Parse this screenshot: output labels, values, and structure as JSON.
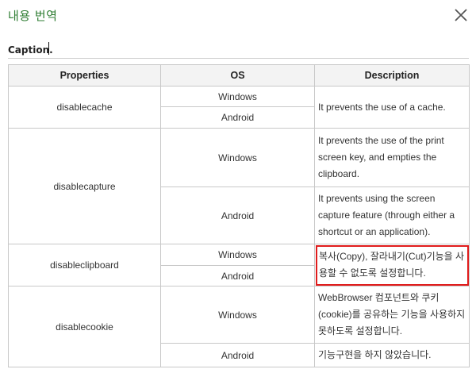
{
  "dialog": {
    "title": "내용 번역",
    "caption": "Caption."
  },
  "table": {
    "headers": [
      "Properties",
      "OS",
      "Description"
    ],
    "rows": [
      {
        "property": "disablecache",
        "windows_os": "Windows",
        "android_os": "Android",
        "description": "It prevents the use of a cache."
      },
      {
        "property": "disablecapture",
        "windows_os": "Windows",
        "android_os": "Android",
        "windows_desc": "It prevents the use of the print screen key, and empties the clipboard.",
        "android_desc": "It prevents using the screen capture feature (through either a shortcut or an application)."
      },
      {
        "property": "disableclipboard",
        "windows_os": "Windows",
        "android_os": "Android",
        "description": "복사(Copy), 잘라내기(Cut)기능을 사용할 수 없도록 설정합니다."
      },
      {
        "property": "disablecookie",
        "windows_os": "Windows",
        "android_os": "Android",
        "windows_desc": "WebBrowser 컴포넌트와 쿠키(cookie)를 공유하는 기능을 사용하지 못하도록 설정합니다.",
        "android_desc": "기능구현을 하지 않았습니다."
      }
    ]
  },
  "highlight_color": "#e01b1b",
  "title_color": "#2e7d32"
}
